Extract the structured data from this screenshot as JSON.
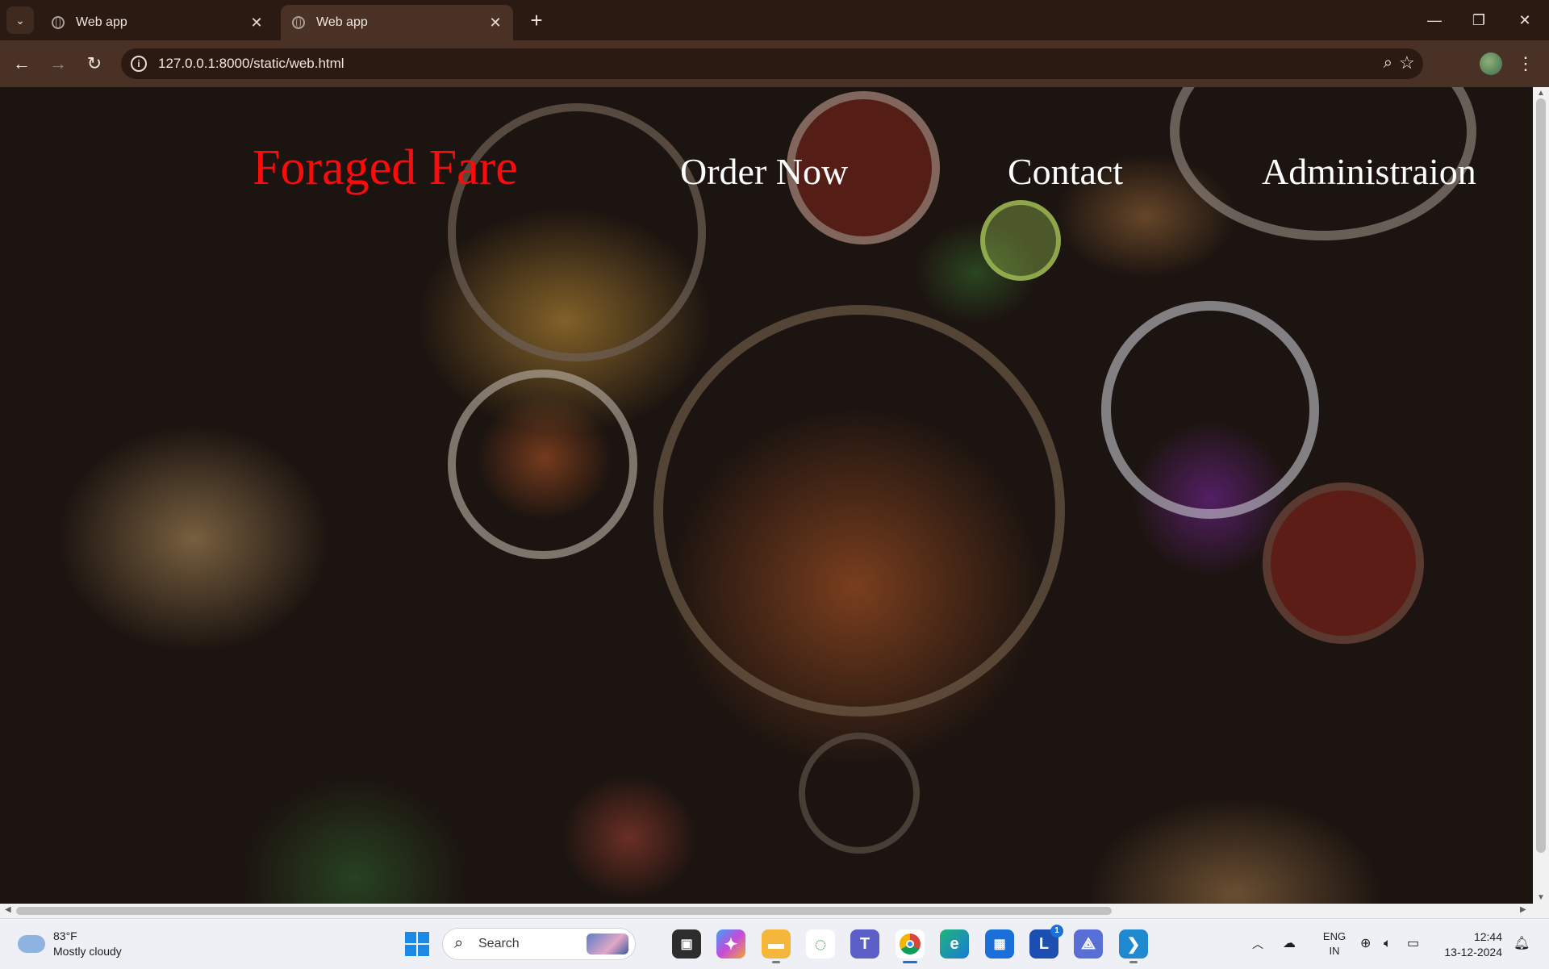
{
  "browser": {
    "tabs": [
      {
        "title": "Web app",
        "active": false
      },
      {
        "title": "Web app",
        "active": true
      }
    ],
    "url": "127.0.0.1:8000/static/web.html"
  },
  "page": {
    "brand": "Foraged Fare",
    "nav": [
      "Order Now",
      "Contact",
      "Administraion"
    ],
    "colors": {
      "brand": "#ff0a0a",
      "nav": "#ffffff"
    }
  },
  "taskbar": {
    "weather": {
      "temp": "83°F",
      "condition": "Mostly cloudy"
    },
    "search_label": "Search",
    "apps": [
      "file-explorer",
      "copilot",
      "files",
      "app-green",
      "teams",
      "chrome",
      "edge",
      "store",
      "l-app",
      "app-a",
      "vscode"
    ],
    "notification_count": "1",
    "language": {
      "line1": "ENG",
      "line2": "IN"
    },
    "time": "12:44",
    "date": "13-12-2024"
  }
}
